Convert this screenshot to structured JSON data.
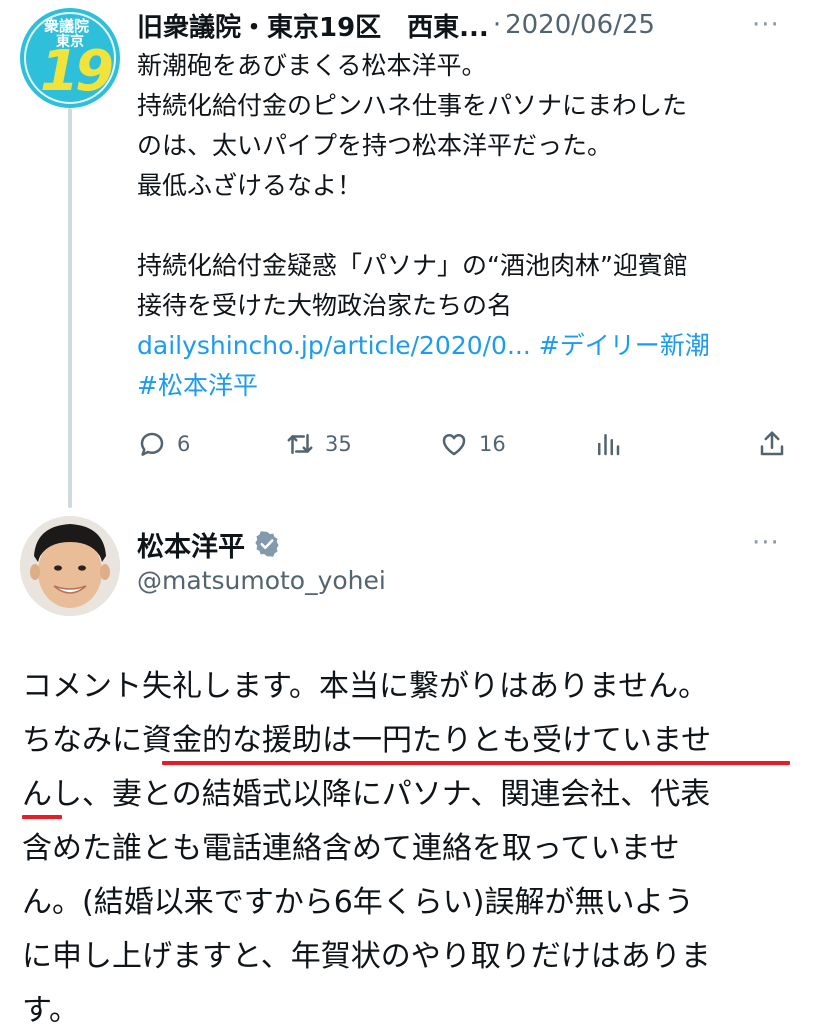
{
  "parent_tweet": {
    "avatar": {
      "top": "衆議院",
      "sub": "東京",
      "number": "19"
    },
    "display_name": "旧衆議院・東京19区　西東...",
    "separator": "·",
    "date": "2020/06/25",
    "text_lines": [
      "新潮砲をあびまくる松本洋平。",
      "持続化給付金のピンハネ仕事をパソナにまわした",
      "のは、太いパイプを持つ松本洋平だった。",
      "最低ふざけるなよ！",
      "",
      "持続化給付金疑惑「パソナ」の“酒池肉林”迎賓館",
      "接待を受けた大物政治家たちの名"
    ],
    "link": "dailyshincho.jp/article/2020/0...",
    "hashtags": [
      "#デイリー新潮",
      "#松本洋平"
    ],
    "actions": {
      "reply_count": "6",
      "retweet_count": "35",
      "like_count": "16"
    }
  },
  "reply_tweet": {
    "display_name": "松本洋平",
    "handle": "@matsumoto_yohei",
    "text_lines": [
      "コメント失礼します。本当に繋がりはありません。",
      "ちなみに資金的な援助は一円たりとも受けていませ",
      "んし、妻との結婚式以降にパソナ、関連会社、代表",
      "含めた誰とも電話連絡含めて連絡を取っていませ",
      "ん。(結婚以来ですから6年くらい)誤解が無いよう",
      "に申し上げますと、年賀状のやり取りだけはありま",
      "す。"
    ]
  },
  "colors": {
    "link": "#1d9bf0",
    "muted": "#536471",
    "underline": "#e81c24",
    "verified": "#829aab"
  },
  "more_label": "···"
}
